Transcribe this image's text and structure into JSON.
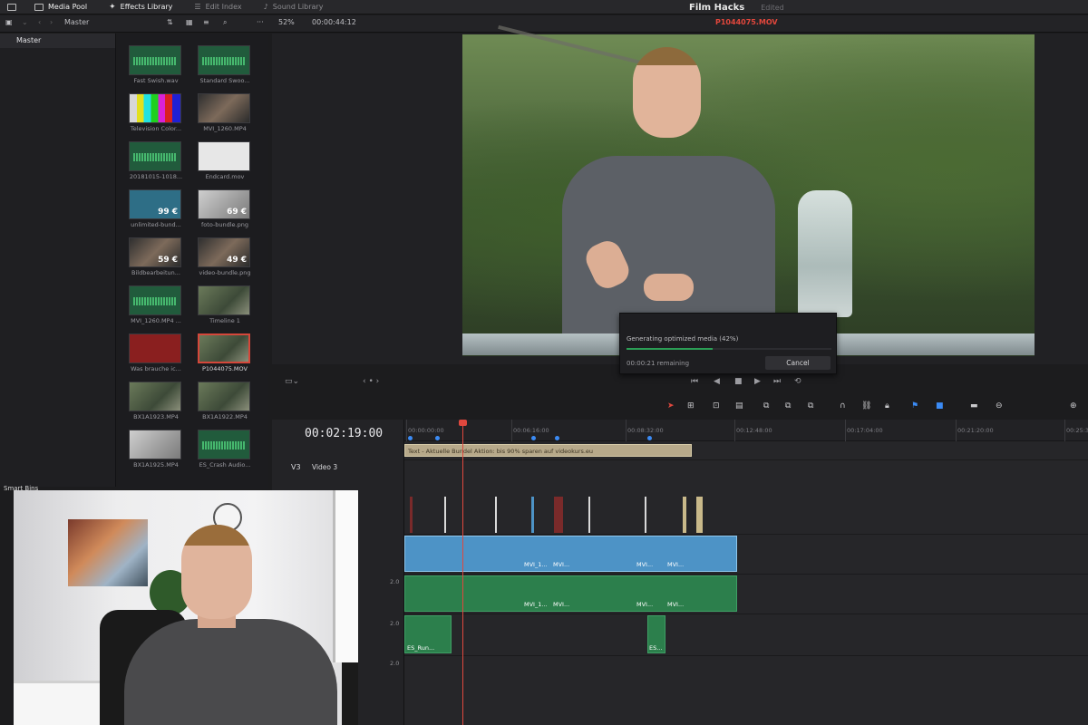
{
  "topbar": {
    "items": [
      {
        "label": "Media Pool",
        "icon": "media-pool-icon",
        "active": true
      },
      {
        "label": "Effects Library",
        "icon": "effects-icon",
        "active": true
      },
      {
        "label": "Edit Index",
        "icon": "list-icon",
        "active": false
      },
      {
        "label": "Sound Library",
        "icon": "sound-icon",
        "active": false
      }
    ],
    "project_title": "Film Hacks",
    "project_status": "Edited"
  },
  "toolbar2": {
    "bin": "Master",
    "zoom": "52%",
    "timecode": "00:00:44:12",
    "clip_name": "P1044075.MOV"
  },
  "bins": {
    "master": "Master",
    "smart_bins": "Smart Bins"
  },
  "media_pool": [
    {
      "label": "Fast Swish.wav",
      "kind": "audio"
    },
    {
      "label": "Standard Swoo...",
      "kind": "audio"
    },
    {
      "label": "Television Color...",
      "kind": "colorbars"
    },
    {
      "label": "MVI_1260.MP4",
      "kind": "video"
    },
    {
      "label": "20181015-1018...",
      "kind": "audio"
    },
    {
      "label": "Endcard.mov",
      "kind": "video"
    },
    {
      "label": "unlimited-bund...",
      "kind": "image",
      "price": "99 €"
    },
    {
      "label": "foto-bundle.png",
      "kind": "image",
      "price": "69 €"
    },
    {
      "label": "Bildbearbeitun...",
      "kind": "image",
      "price": "59 €"
    },
    {
      "label": "video-bundle.png",
      "kind": "image",
      "price": "49 €"
    },
    {
      "label": "MVI_1260.MP4 ...",
      "kind": "audio"
    },
    {
      "label": "Timeline 1",
      "kind": "timeline"
    },
    {
      "label": "Was brauche ic...",
      "kind": "video"
    },
    {
      "label": "P1044075.MOV",
      "kind": "video",
      "selected": true
    },
    {
      "label": "BX1A1923.MP4",
      "kind": "video"
    },
    {
      "label": "BX1A1922.MP4",
      "kind": "video"
    },
    {
      "label": "BX1A1925.MP4",
      "kind": "video"
    },
    {
      "label": "ES_Crash Audio...",
      "kind": "audio"
    }
  ],
  "dialog": {
    "title": "Generating optimized media (42%)",
    "progress": 0.42,
    "remaining": "00:00:21 remaining",
    "cancel_label": "Cancel"
  },
  "timeline": {
    "timecode": "00:02:19:00",
    "track_v3_id": "V3",
    "track_v3_name": "Video 3",
    "ruler_labels": [
      "00:00:00:00",
      "00:06:16:00",
      "00:08:32:00",
      "00:12:48:00",
      "00:17:04:00",
      "00:21:20:00",
      "00:25:3"
    ],
    "title_clip": "Text - Aktuelle Bundel Aktion: bis 90% sparen auf videokurs.eu",
    "clip_labels": [
      "MVI_1...",
      "MVI...",
      "MVI...",
      "MVI...",
      "MVI...",
      "MVI_1...",
      "MVI...",
      "MVI...",
      "MVI..."
    ],
    "audio_clip_labels": [
      "ES_Run...",
      "ES..."
    ],
    "track_values": [
      "2.0",
      "2.0",
      "2.0"
    ]
  }
}
